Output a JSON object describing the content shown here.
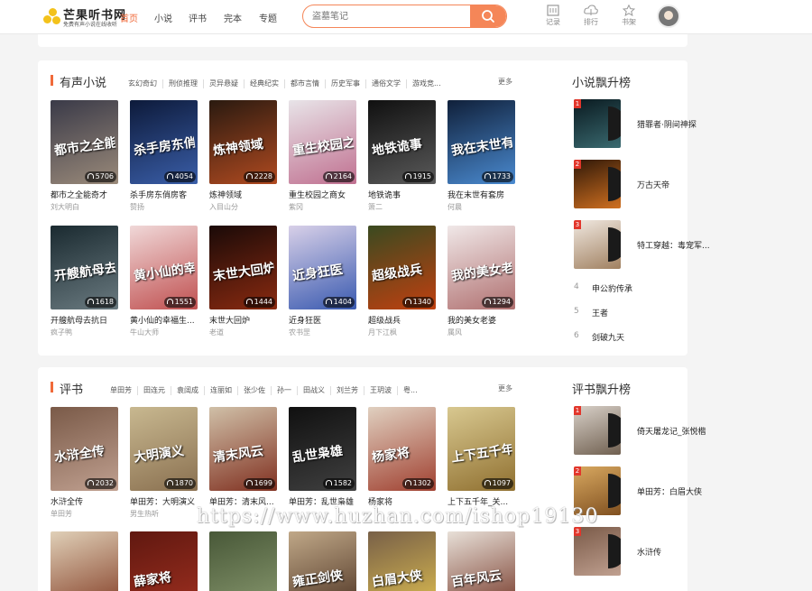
{
  "header": {
    "logo_name": "芒果听书网",
    "logo_slogan": "免费有声小说在线收听",
    "nav": [
      "首页",
      "小说",
      "评书",
      "完本",
      "专题"
    ],
    "active_nav": "首页",
    "search_placeholder": "盗墓笔记",
    "icons": [
      {
        "label": "记录",
        "icon": "history-icon"
      },
      {
        "label": "排行",
        "icon": "ranking-icon"
      },
      {
        "label": "书架",
        "icon": "bookshelf-icon"
      }
    ],
    "accent": "#f58658"
  },
  "novels": {
    "title": "有声小说",
    "tabs": [
      "玄幻奇幻",
      "刑侦推理",
      "灵异悬疑",
      "经典纪实",
      "都市言情",
      "历史军事",
      "通俗文学",
      "游戏竞..."
    ],
    "more": "更多",
    "books": [
      {
        "title": "都市之全能奇才",
        "author": "刘大明白",
        "plays": "5706",
        "cover_text": "都市之全能奇才",
        "colors": [
          "#3a3a48",
          "#9a8a7a"
        ]
      },
      {
        "title": "杀手房东俏房客",
        "author": "赞扬",
        "plays": "4054",
        "cover_text": "杀手房东俏房客",
        "colors": [
          "#0d1a3a",
          "#3a5ea8"
        ]
      },
      {
        "title": "炼神领域",
        "author": "入目山分",
        "plays": "2228",
        "cover_text": "炼神领域",
        "colors": [
          "#2a1a10",
          "#b04a20"
        ]
      },
      {
        "title": "重生校园之商女",
        "author": "紫冈",
        "plays": "2164",
        "cover_text": "重生校园之商女",
        "colors": [
          "#e8e4e8",
          "#c07090"
        ]
      },
      {
        "title": "地铁诡事",
        "author": "箫二",
        "plays": "1915",
        "cover_text": "地铁诡事",
        "colors": [
          "#101010",
          "#5a5a5a"
        ]
      },
      {
        "title": "我在末世有套房",
        "author": "何晨",
        "plays": "1733",
        "cover_text": "我在末世有套房",
        "colors": [
          "#10203a",
          "#4a8ad0"
        ]
      },
      {
        "title": "开艘航母去抗日",
        "author": "疯子鸭",
        "plays": "1618",
        "cover_text": "开艘航母去抗日",
        "colors": [
          "#1a2a30",
          "#6a7a80"
        ]
      },
      {
        "title": "黄小仙的幸福生...",
        "author": "牛山大师",
        "plays": "1551",
        "cover_text": "黄小仙的幸福生活",
        "colors": [
          "#f0d8d8",
          "#c05050"
        ]
      },
      {
        "title": "末世大回炉",
        "author": "老道",
        "plays": "1444",
        "cover_text": "末世大回炉",
        "colors": [
          "#1a0a08",
          "#8a2a10"
        ]
      },
      {
        "title": "近身狂医",
        "author": "农书罡",
        "plays": "1404",
        "cover_text": "近身狂医",
        "colors": [
          "#d8d0e8",
          "#3a5ab0"
        ]
      },
      {
        "title": "超级战兵",
        "author": "月下江枫",
        "plays": "1340",
        "cover_text": "超级战兵",
        "colors": [
          "#3a4a20",
          "#c04010"
        ]
      },
      {
        "title": "我的美女老婆",
        "author": "属风",
        "plays": "1294",
        "cover_text": "我的美女老婆",
        "colors": [
          "#f0e8e8",
          "#b07070"
        ]
      }
    ]
  },
  "novel_rank": {
    "title": "小说飘升榜",
    "top": [
      {
        "rank": "1",
        "name": "猎罪者·阴间神探",
        "colors": [
          "#0a1a20",
          "#3a6a70"
        ]
      },
      {
        "rank": "2",
        "name": "万古天帝",
        "colors": [
          "#301808",
          "#d07020"
        ]
      },
      {
        "rank": "3",
        "name": "特工穿越：毒宠军...",
        "colors": [
          "#f0e8e0",
          "#a08060"
        ]
      }
    ],
    "rest": [
      {
        "rank": "4",
        "name": "申公豹传承"
      },
      {
        "rank": "5",
        "name": "王者"
      },
      {
        "rank": "6",
        "name": "剑破九天"
      }
    ]
  },
  "pingshu": {
    "title": "评书",
    "tabs": [
      "单田芳",
      "田连元",
      "袁阔成",
      "连丽如",
      "张少佐",
      "孙一",
      "田战义",
      "刘兰芳",
      "王玥波",
      "粤..."
    ],
    "more": "更多",
    "books": [
      {
        "title": "水浒全传",
        "author": "单田芳",
        "plays": "2032",
        "cover_text": "水浒全传",
        "colors": [
          "#7a5a48",
          "#c0a090"
        ]
      },
      {
        "title": "单田芳：大明演义",
        "author": "男生热听",
        "plays": "1870",
        "cover_text": "大明演义",
        "colors": [
          "#c8b890",
          "#8a7050"
        ]
      },
      {
        "title": "单田芳：清末风...",
        "author": "",
        "plays": "1699",
        "cover_text": "清末风云",
        "colors": [
          "#d0c0a8",
          "#803020"
        ]
      },
      {
        "title": "单田芳：乱世枭雄",
        "author": "",
        "plays": "1582",
        "cover_text": "乱世枭雄",
        "colors": [
          "#101010",
          "#404040"
        ]
      },
      {
        "title": "杨家将",
        "author": "",
        "plays": "1302",
        "cover_text": "杨家将",
        "colors": [
          "#e0d0c0",
          "#a04030"
        ]
      },
      {
        "title": "上下五千年_关...",
        "author": "",
        "plays": "1097",
        "cover_text": "上下五千年",
        "colors": [
          "#d8c890",
          "#907030"
        ]
      },
      {
        "title": "",
        "author": "",
        "plays": "",
        "cover_text": "",
        "colors": [
          "#e0d0b8",
          "#803820"
        ]
      },
      {
        "title": "",
        "author": "",
        "plays": "",
        "cover_text": "薛家将",
        "colors": [
          "#601810",
          "#a03020"
        ]
      },
      {
        "title": "",
        "author": "",
        "plays": "",
        "cover_text": "",
        "colors": [
          "#485838",
          "#8a9a70"
        ]
      },
      {
        "title": "",
        "author": "",
        "plays": "",
        "cover_text": "雍正剑侠",
        "colors": [
          "#c0a888",
          "#4a3020"
        ]
      },
      {
        "title": "",
        "author": "",
        "plays": "",
        "cover_text": "白眉大侠",
        "colors": [
          "#786048",
          "#e0c050"
        ]
      },
      {
        "title": "",
        "author": "",
        "plays": "",
        "cover_text": "百年风云",
        "colors": [
          "#e8e0d8",
          "#703020"
        ]
      }
    ]
  },
  "pingshu_rank": {
    "title": "评书飘升榜",
    "top": [
      {
        "rank": "1",
        "name": "倚天屠龙记_张悦楷",
        "colors": [
          "#d8d0c8",
          "#706050"
        ]
      },
      {
        "rank": "2",
        "name": "单田芳：白眉大侠",
        "colors": [
          "#d8a860",
          "#805020"
        ]
      },
      {
        "rank": "3",
        "name": "水浒传",
        "colors": [
          "#7a5a48",
          "#c0a090"
        ]
      }
    ]
  },
  "watermark": "https://www.huzhan.com/ishop19130"
}
